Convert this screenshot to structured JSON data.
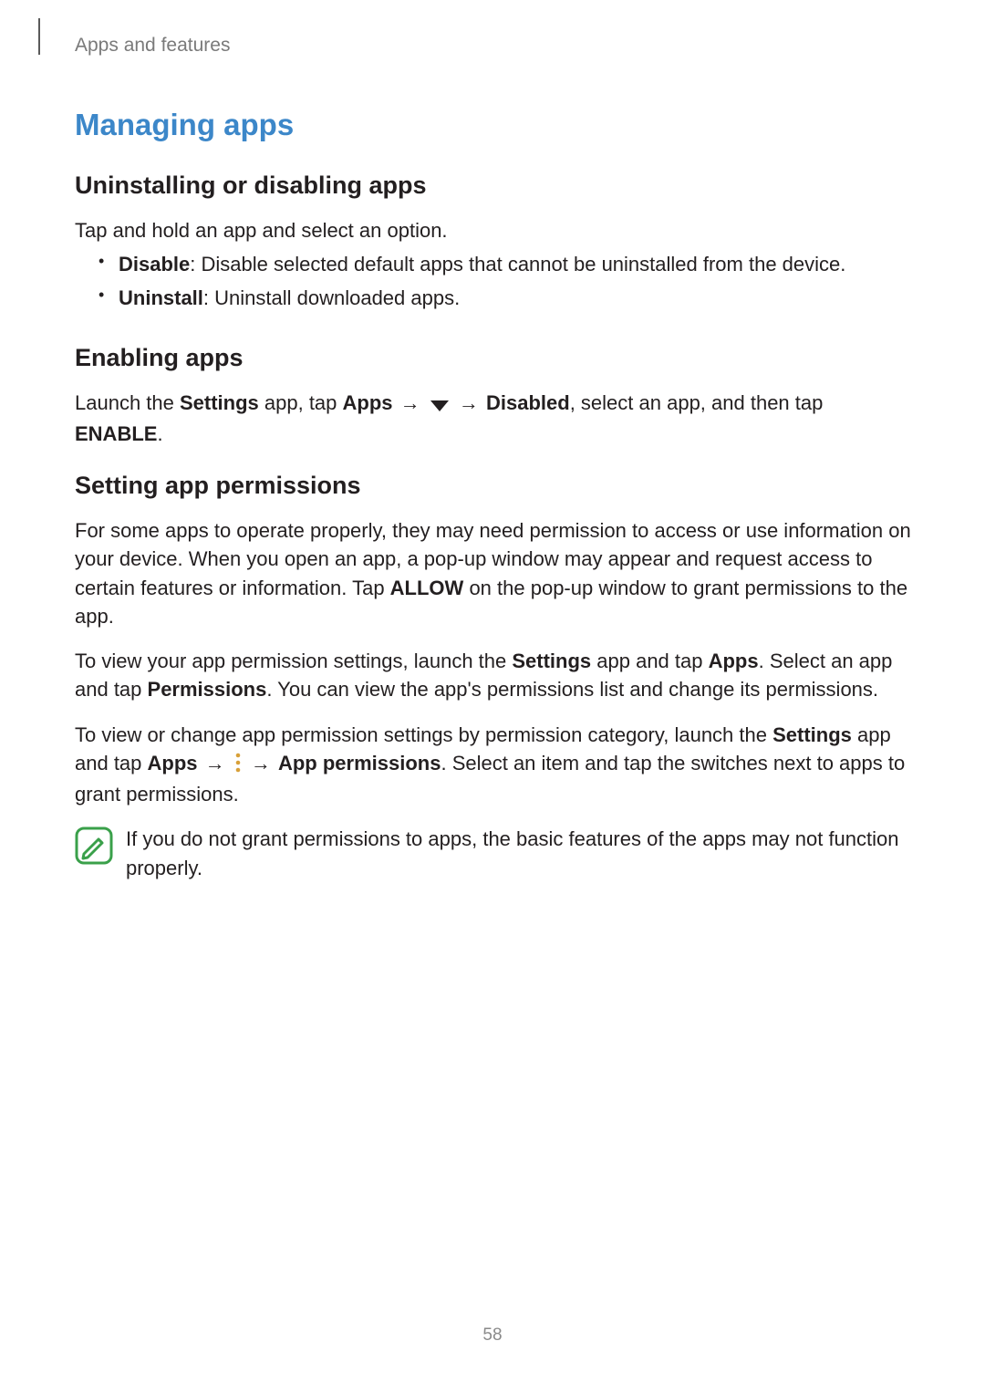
{
  "header": {
    "chapter": "Apps and features"
  },
  "title": "Managing apps",
  "sections": {
    "uninstall": {
      "heading": "Uninstalling or disabling apps",
      "intro": "Tap and hold an app and select an option.",
      "items": [
        {
          "label": "Disable",
          "desc": ": Disable selected default apps that cannot be uninstalled from the device."
        },
        {
          "label": "Uninstall",
          "desc": ": Uninstall downloaded apps."
        }
      ]
    },
    "enable": {
      "heading": "Enabling apps",
      "para": {
        "pre": "Launch the ",
        "settings": "Settings",
        "mid1": " app, tap ",
        "apps": "Apps",
        "arrow1": " → ",
        "arrow2": " → ",
        "disabled": "Disabled",
        "mid2": ", select an app, and then tap ",
        "enable": "ENABLE",
        "end": "."
      }
    },
    "perm": {
      "heading": "Setting app permissions",
      "p1": {
        "a": "For some apps to operate properly, they may need permission to access or use information on your device. When you open an app, a pop-up window may appear and request access to certain features or information. Tap ",
        "allow": "ALLOW",
        "b": " on the pop-up window to grant permissions to the app."
      },
      "p2": {
        "a": "To view your app permission settings, launch the ",
        "settings": "Settings",
        "b": " app and tap ",
        "apps": "Apps",
        "c": ". Select an app and tap ",
        "permissions": "Permissions",
        "d": ". You can view the app's permissions list and change its permissions."
      },
      "p3": {
        "a": "To view or change app permission settings by permission category, launch the ",
        "settings": "Settings",
        "b": " app and tap ",
        "apps": "Apps",
        "arrow1": " → ",
        "arrow2": " → ",
        "appperm": "App permissions",
        "c": ". Select an item and tap the switches next to apps to grant permissions."
      },
      "note": "If you do not grant permissions to apps, the basic features of the apps may not function properly."
    }
  },
  "icons": {
    "dropdown": "dropdown-triangle-icon",
    "more": "more-vertical-icon",
    "note": "note-pencil-icon"
  },
  "pageNumber": "58"
}
